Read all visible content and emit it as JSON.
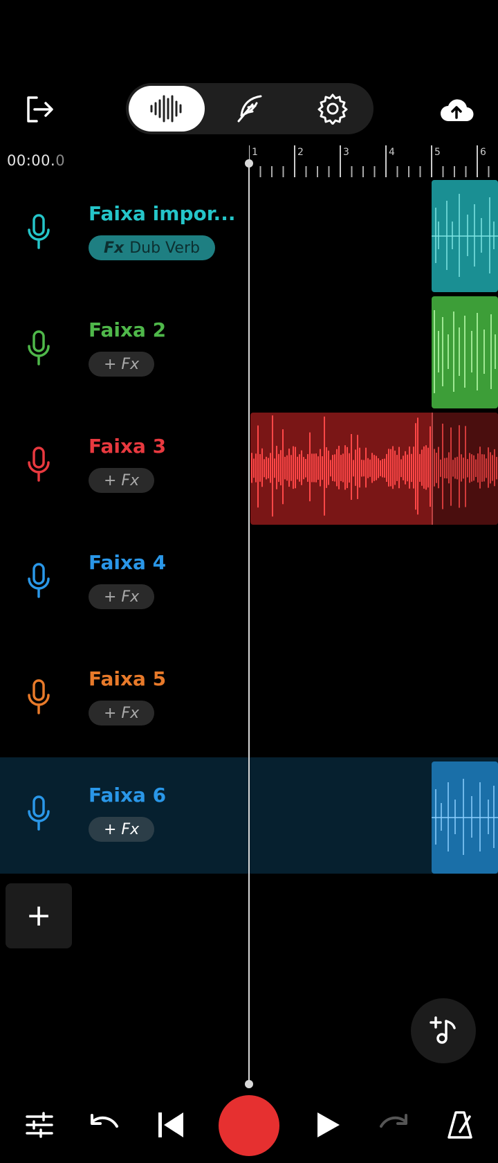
{
  "header": {
    "exit_icon": "exit-icon",
    "modes": [
      {
        "icon": "waveform-icon",
        "active": true
      },
      {
        "icon": "feather-icon",
        "active": false
      },
      {
        "icon": "gear-icon",
        "active": false
      }
    ],
    "cloud_icon": "cloud-upload-icon"
  },
  "timeline": {
    "time_main": "00:00.",
    "time_frac": "0",
    "ruler_labels": [
      "1",
      "2",
      "3",
      "4",
      "5",
      "6"
    ]
  },
  "tracks": [
    {
      "name": "Faixa impor...",
      "color": "#25c5c9",
      "fx_label": "Fx",
      "fx_value": "Dub Verb",
      "has_fx": true
    },
    {
      "name": "Faixa 2",
      "color": "#4fb84a",
      "fx_label": "+ Fx",
      "has_fx": false
    },
    {
      "name": "Faixa 3",
      "color": "#e8393f",
      "fx_label": "+ Fx",
      "has_fx": false
    },
    {
      "name": "Faixa 4",
      "color": "#2a97e8",
      "fx_label": "+ Fx",
      "has_fx": false
    },
    {
      "name": "Faixa 5",
      "color": "#e87a2a",
      "fx_label": "+ Fx",
      "has_fx": false
    },
    {
      "name": "Faixa 6",
      "color": "#2a97e8",
      "fx_label": "+ Fx",
      "has_fx": false,
      "selected": true
    }
  ],
  "add_track_label": "+",
  "bottom": {
    "icons": [
      "mixer-sliders-icon",
      "undo-icon",
      "skip-back-icon",
      "record-icon",
      "play-icon",
      "redo-icon",
      "metronome-icon"
    ]
  },
  "colors": {
    "background": "#000000",
    "record": "#e63030",
    "selected_track": "#06202f"
  }
}
